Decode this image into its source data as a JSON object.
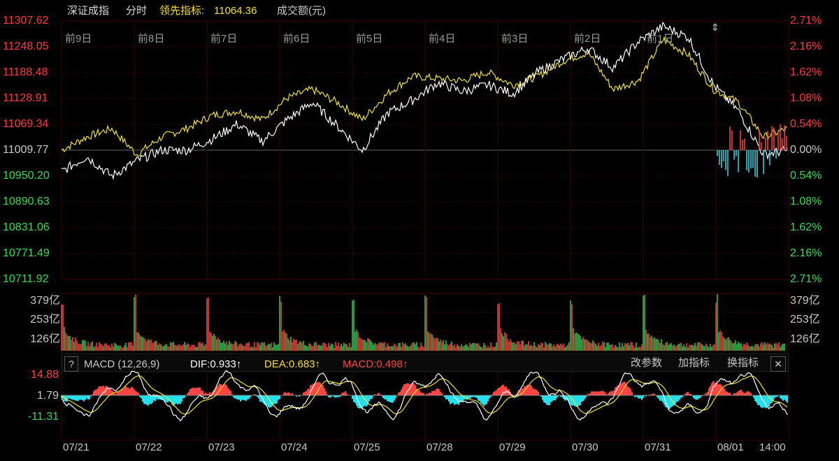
{
  "header": {
    "name": "深证成指",
    "mode": "分时",
    "lead_label": "领先指标:",
    "lead_value": "11064.36",
    "vol_label": "成交额(元)"
  },
  "price_axis": [
    "11307.62",
    "11248.05",
    "11188.48",
    "11128.91",
    "11069.34",
    "11009.77",
    "10950.20",
    "10890.63",
    "10831.06",
    "10771.49",
    "10711.92"
  ],
  "pct_axis": [
    "2.71%",
    "2.16%",
    "1.62%",
    "1.08%",
    "0.54%",
    "0.00%",
    "0.54%",
    "1.08%",
    "1.62%",
    "2.16%",
    "2.71%"
  ],
  "day_labels": [
    "前9日",
    "前8日",
    "前7日",
    "前6日",
    "前5日",
    "前4日",
    "前3日",
    "前2日",
    "前1日"
  ],
  "vol_axis": [
    "379亿",
    "253亿",
    "126亿"
  ],
  "macd": {
    "help": "?",
    "title": "MACD (12,26,9)",
    "dif": "DIF:0.933↑",
    "dea": "DEA:0.683↑",
    "macd": "MACD:0.498↑",
    "btn_params": "改参数",
    "btn_add": "加指标",
    "btn_switch": "换指标",
    "close": "✕",
    "axis": [
      "14.88",
      "1.79",
      "-11.31"
    ]
  },
  "x_labels": [
    "07/21",
    "07/22",
    "07/23",
    "07/24",
    "07/25",
    "07/28",
    "07/29",
    "07/30",
    "07/31",
    "08/01",
    "14:00"
  ],
  "colors": {
    "up": "#ff4444",
    "down": "#22e0ee",
    "white": "#ffffff",
    "yellow": "#f2e22a",
    "grid": "#3a0000"
  },
  "chart_data": {
    "type": "line",
    "title": "深证成指 分时",
    "ylim": [
      10711.92,
      11307.62
    ],
    "base": 11009.77,
    "categories": [
      "07/21",
      "07/22",
      "07/23",
      "07/24",
      "07/25",
      "07/28",
      "07/29",
      "07/30",
      "07/31",
      "08/01"
    ],
    "series": [
      {
        "name": "price",
        "values": [
          10960,
          10995,
          10950,
          10985,
          11010,
          11010,
          11035,
          11070,
          11030,
          11080,
          11120,
          11065,
          11010,
          11095,
          11125,
          11165,
          11145,
          11160,
          11140,
          11190,
          11220,
          11245,
          11200,
          11260,
          11295,
          11270,
          11160,
          11100,
          11000,
          11010
        ]
      },
      {
        "name": "lead",
        "values": [
          11010,
          11040,
          11060,
          11000,
          11040,
          11060,
          11090,
          11100,
          11080,
          11130,
          11150,
          11120,
          11080,
          11140,
          11180,
          11175,
          11170,
          11190,
          11160,
          11180,
          11215,
          11235,
          11150,
          11170,
          11265,
          11230,
          11150,
          11120,
          11040,
          11060
        ]
      }
    ],
    "volume_ylim": [
      0,
      379
    ]
  }
}
